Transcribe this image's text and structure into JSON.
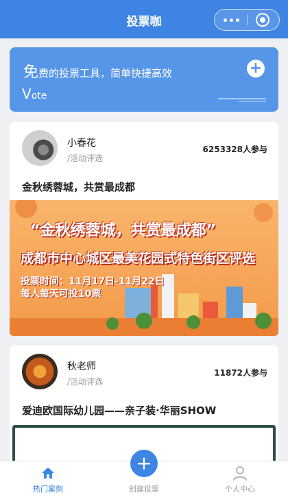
{
  "header": {
    "title": "投票咖"
  },
  "banner": {
    "slogan_big": "免",
    "slogan_rest": "费的投票工具，简单快捷高效",
    "vote_big": "V",
    "vote_rest": "ote"
  },
  "cards": [
    {
      "author": "小春花",
      "category": "/活动评选",
      "participants": "6253328人参与",
      "title": "金秋绣蓉城，共赏最成都",
      "cover": {
        "line1": "“金秋绣蓉城，共赏最成都”",
        "line2": "成都市中心城区最美花园式特色街区评选",
        "line3": "投票时间：11月17日-11月22日",
        "line4": "每人每天可投10票"
      }
    },
    {
      "author": "秋老师",
      "category": "/活动评选",
      "participants": "11872人参与",
      "title": "爱迪欧国际幼儿园——亲子装·华丽SHOW"
    }
  ],
  "tabbar": {
    "home": "热门案例",
    "create": "创建投票",
    "me": "个人中心"
  },
  "colors": {
    "primary": "#3d84e3",
    "banner": "#5696e9",
    "cover": "#f6a558"
  },
  "icons": [
    "more-icon",
    "close-target-icon",
    "plus-icon",
    "home-icon",
    "user-icon"
  ]
}
